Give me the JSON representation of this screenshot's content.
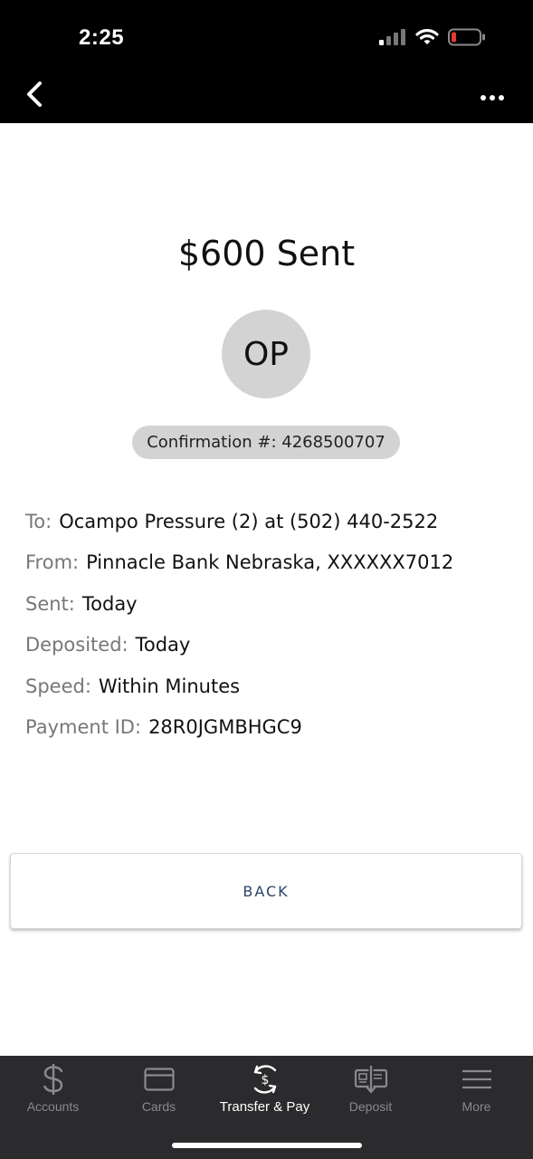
{
  "status": {
    "time": "2:25",
    "icons": [
      "cellular-signal-icon",
      "wifi-icon",
      "battery-low-icon"
    ]
  },
  "nav": {
    "back_icon": "chevron-left-icon",
    "more_icon": "ellipsis-icon"
  },
  "main": {
    "headline": "$600 Sent",
    "avatar_initials": "OP",
    "confirmation": "Confirmation #: 4268500707",
    "details": [
      {
        "label": "To:",
        "value": "Ocampo Pressure (2) at (502) 440-2522"
      },
      {
        "label": "From:",
        "value": "Pinnacle Bank Nebraska, XXXXXX7012"
      },
      {
        "label": "Sent:",
        "value": "Today"
      },
      {
        "label": "Deposited:",
        "value": "Today"
      },
      {
        "label": "Speed:",
        "value": "Within Minutes"
      },
      {
        "label": "Payment ID:",
        "value": "28R0JGMBHGC9"
      }
    ],
    "back_button": "BACK"
  },
  "tabbar": {
    "tabs": [
      {
        "label": "Accounts",
        "icon": "dollar-icon"
      },
      {
        "label": "Cards",
        "icon": "card-icon"
      },
      {
        "label": "Transfer & Pay",
        "icon": "transfer-pay-icon"
      },
      {
        "label": "Deposit",
        "icon": "check-deposit-icon"
      },
      {
        "label": "More",
        "icon": "menu-icon"
      }
    ],
    "active": "Transfer & Pay"
  },
  "colors": {
    "accent": "#2a4468",
    "avatar_bg": "#d3d3d3",
    "tabbar_bg": "#2b2b2d",
    "battery_low": "#e53935"
  }
}
